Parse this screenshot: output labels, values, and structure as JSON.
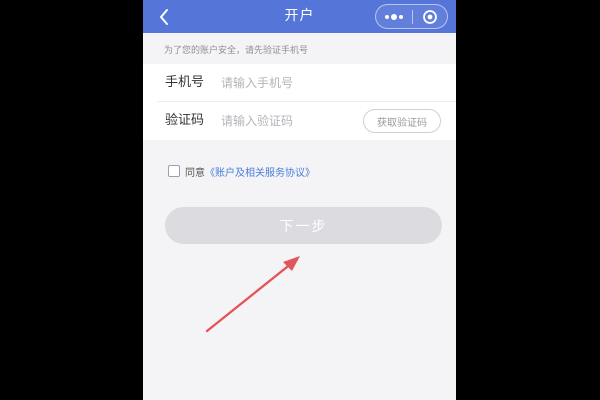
{
  "navbar": {
    "title": "开户",
    "back_icon": "chevron-left-icon",
    "more_icon": "more-dots-icon",
    "close_icon": "target-circle-icon",
    "color": "#5575d9"
  },
  "tip": "为了您的账户安全，请先验证手机号",
  "form": {
    "phone": {
      "label": "手机号",
      "placeholder": "请输入手机号",
      "value": ""
    },
    "code": {
      "label": "验证码",
      "placeholder": "请输入验证码",
      "value": "",
      "get_code_label": "获取验证码"
    }
  },
  "agreement": {
    "checked": false,
    "prefix": "同意",
    "link": "《账户及相关服务协议》",
    "link_color": "#4a7ddb"
  },
  "next_button": {
    "label": "下一步",
    "disabled": true
  },
  "annotation": {
    "arrow_color": "#e0565b"
  }
}
